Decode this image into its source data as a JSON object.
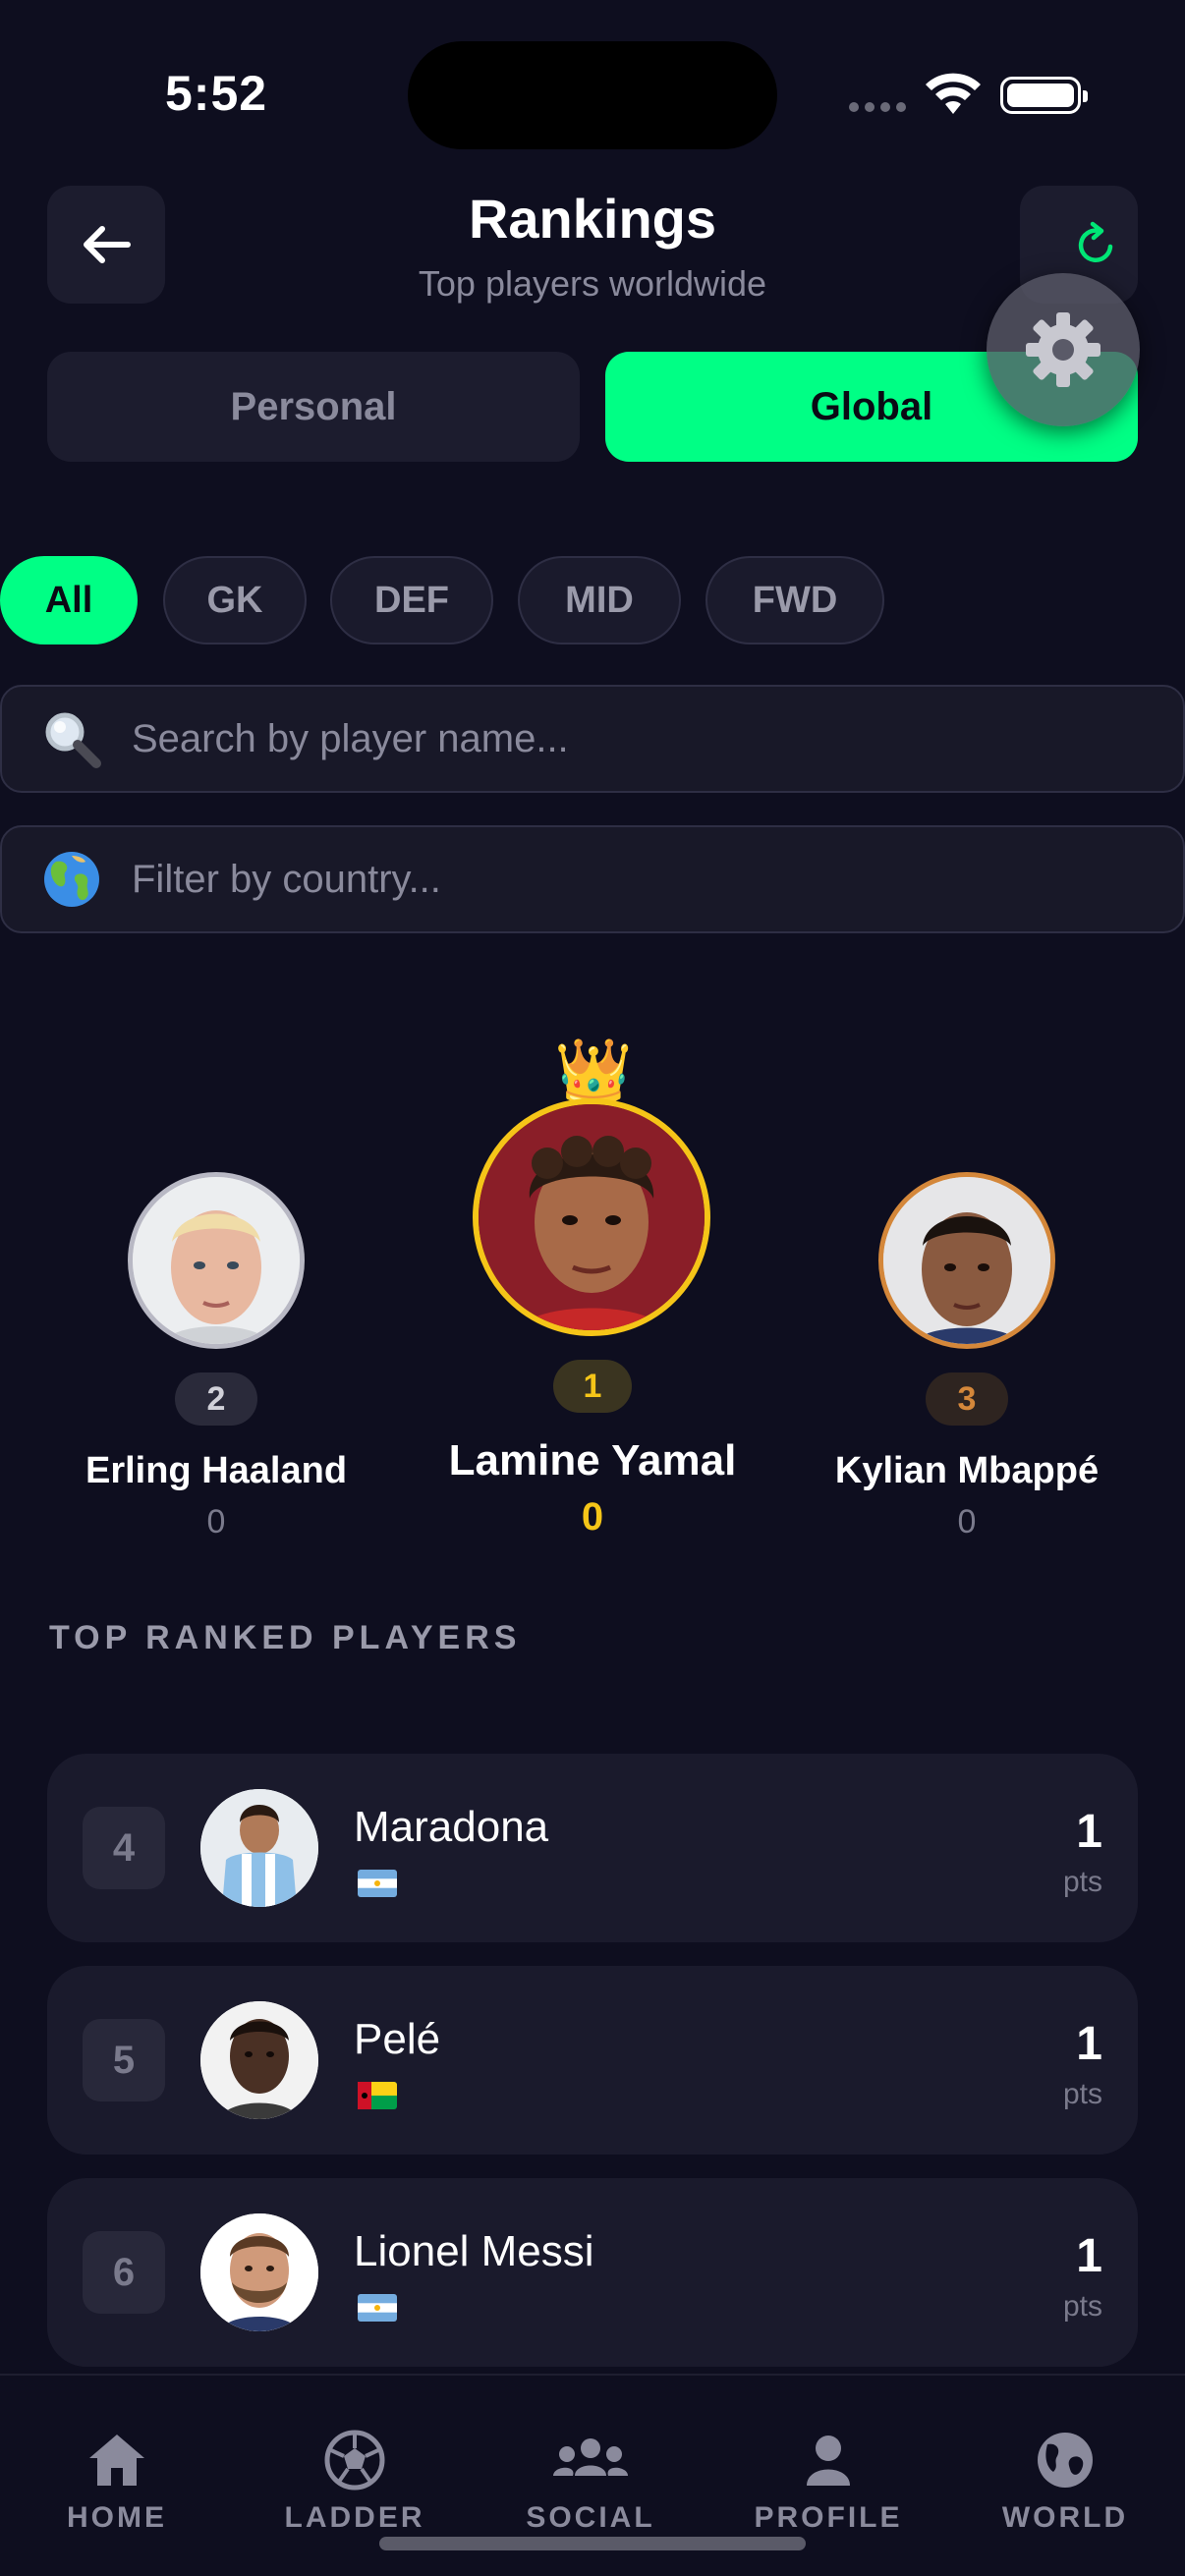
{
  "status_bar": {
    "time": "5:52"
  },
  "header": {
    "title": "Rankings",
    "subtitle": "Top players worldwide"
  },
  "mode_toggle": {
    "personal": "Personal",
    "global": "Global",
    "selected": "Global"
  },
  "position_filters": [
    {
      "label": "All",
      "active": true
    },
    {
      "label": "GK",
      "active": false
    },
    {
      "label": "DEF",
      "active": false
    },
    {
      "label": "MID",
      "active": false
    },
    {
      "label": "FWD",
      "active": false
    }
  ],
  "search": {
    "icon": "magnifier-emoji",
    "placeholder": "Search by player name..."
  },
  "country_filter": {
    "icon": "globe-emoji",
    "placeholder": "Filter by country..."
  },
  "podium": {
    "crown_icon": "👑",
    "first": {
      "rank": "1",
      "name": "Lamine Yamal",
      "points": "0"
    },
    "second": {
      "rank": "2",
      "name": "Erling Haaland",
      "points": "0"
    },
    "third": {
      "rank": "3",
      "name": "Kylian Mbappé",
      "points": "0"
    }
  },
  "list": {
    "section_title": "TOP RANKED PLAYERS",
    "rows": [
      {
        "rank": "4",
        "name": "Maradona",
        "flag": "argentina-flag",
        "points": "1",
        "points_label": "pts"
      },
      {
        "rank": "5",
        "name": "Pelé",
        "flag": "guinea-bissau-flag",
        "points": "1",
        "points_label": "pts"
      },
      {
        "rank": "6",
        "name": "Lionel Messi",
        "flag": "argentina-flag",
        "points": "1",
        "points_label": "pts"
      }
    ]
  },
  "tab_bar": [
    {
      "label": "HOME",
      "icon": "house-icon"
    },
    {
      "label": "LADDER",
      "icon": "soccer-ball-icon"
    },
    {
      "label": "SOCIAL",
      "icon": "people-icon"
    },
    {
      "label": "PROFILE",
      "icon": "person-icon"
    },
    {
      "label": "WORLD",
      "icon": "globe-icon"
    }
  ],
  "colors": {
    "background": "#0e0e1f",
    "accent": "#00ff85",
    "gold": "#f5c518",
    "silver": "#b8b8c4",
    "bronze": "#d4873a"
  }
}
